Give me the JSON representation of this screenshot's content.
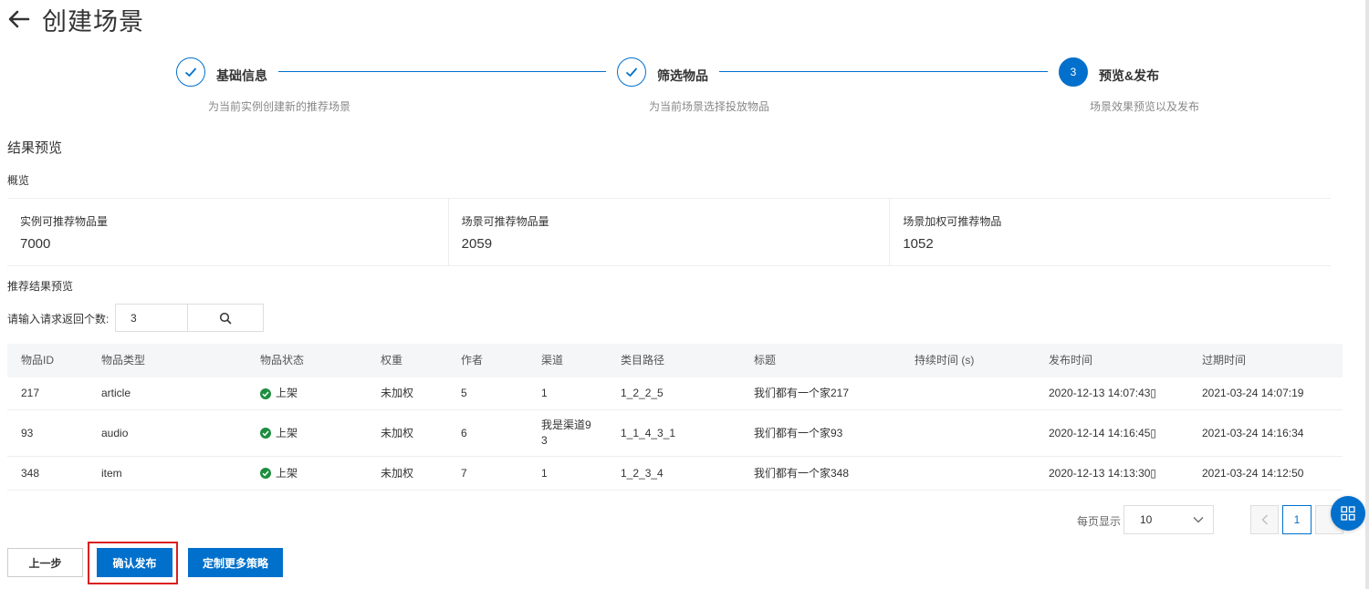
{
  "header": {
    "title": "创建场景"
  },
  "steps": [
    {
      "title": "基础信息",
      "desc": "为当前实例创建新的推荐场景",
      "status": "done"
    },
    {
      "title": "筛选物品",
      "desc": "为当前场景选择投放物品",
      "status": "done"
    },
    {
      "number": "3",
      "title": "预览&发布",
      "desc": "场景效果预览以及发布",
      "status": "active"
    }
  ],
  "section": {
    "title": "结果预览",
    "overview": "概览"
  },
  "stats": [
    {
      "label": "实例可推荐物品量",
      "value": "7000"
    },
    {
      "label": "场景可推荐物品量",
      "value": "2059"
    },
    {
      "label": "场景加权可推荐物品",
      "value": "1052"
    }
  ],
  "recommend": {
    "title": "推荐结果预览",
    "input_label": "请输入请求返回个数:",
    "input_value": "3"
  },
  "table": {
    "headers": [
      "物品ID",
      "物品类型",
      "物品状态",
      "权重",
      "作者",
      "渠道",
      "类目路径",
      "标题",
      "持续时间 (s)",
      "发布时间",
      "过期时间"
    ],
    "rows": [
      {
        "id": "217",
        "type": "article",
        "status": "上架",
        "weight": "未加权",
        "author": "5",
        "channel": "1",
        "category": "1_2_2_5",
        "title": "我们都有一个家217",
        "duration": "",
        "publish": "2020-12-13 14:07:43▯",
        "expire": "2021-03-24 14:07:19"
      },
      {
        "id": "93",
        "type": "audio",
        "status": "上架",
        "weight": "未加权",
        "author": "6",
        "channel": "我是渠道9\n3",
        "category": "1_1_4_3_1",
        "title": "我们都有一个家93",
        "duration": "",
        "publish": "2020-12-14 14:16:45▯",
        "expire": "2021-03-24 14:16:34"
      },
      {
        "id": "348",
        "type": "item",
        "status": "上架",
        "weight": "未加权",
        "author": "7",
        "channel": "1",
        "category": "1_2_3_4",
        "title": "我们都有一个家348",
        "duration": "",
        "publish": "2020-12-13 14:13:30▯",
        "expire": "2021-03-24 14:12:50"
      }
    ]
  },
  "pagination": {
    "page_size_label": "每页显示",
    "page_size": "10",
    "current_page": "1"
  },
  "buttons": {
    "prev": "上一步",
    "confirm": "确认发布",
    "more": "定制更多策略"
  },
  "colors": {
    "primary": "#0070cc",
    "success": "#1e8e3e",
    "highlight": "#d9201f"
  }
}
